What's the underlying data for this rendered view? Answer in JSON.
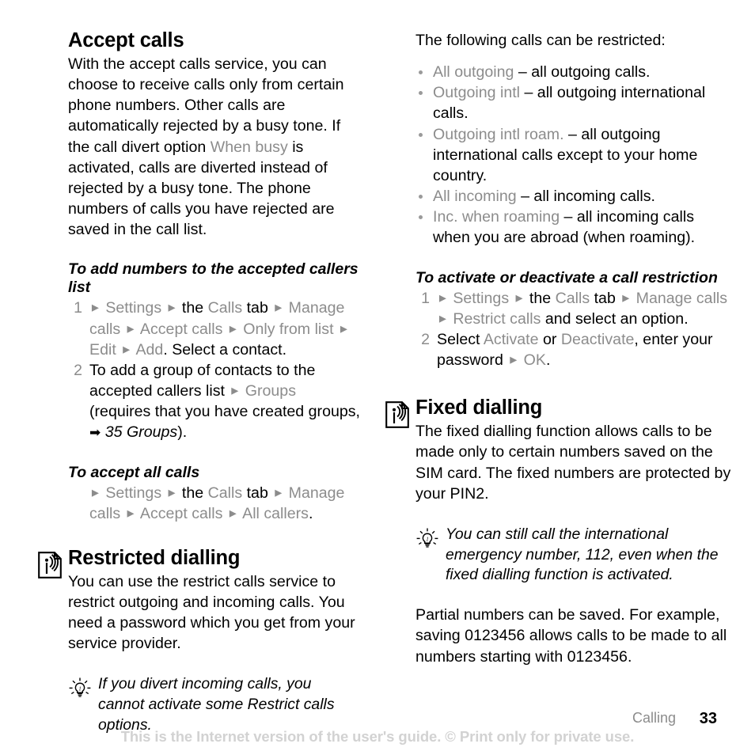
{
  "document": {
    "page_number": "33",
    "chapter": "Calling",
    "notice": "This is the Internet version of the user's guide. © Print only for private use."
  },
  "left_column": {
    "accept_calls": {
      "heading": "Accept calls",
      "intro_part1": "With the accept calls service, you can choose to receive calls only from certain phone numbers. Other calls are automatically rejected by a busy tone. If the call divert option ",
      "intro_menu": "When busy",
      "intro_part2": " is activated, calls are diverted instead of rejected by a busy tone. The phone numbers of calls you have rejected are saved in the call list."
    },
    "add_numbers_task": {
      "heading": "To add numbers to the accepted callers list",
      "step1": {
        "num": "1",
        "m_settings": "Settings",
        "the": "the",
        "m_calls_tab": "Calls",
        "tab_word": "tab",
        "m_manage_calls": "Manage calls",
        "m_accept_calls": "Accept calls",
        "m_only_from_list": "Only from list",
        "m_edit": "Edit",
        "m_add": "Add",
        "tail": ". Select a contact."
      },
      "step2": {
        "num": "2",
        "text_before": "To add a group of contacts to the accepted callers list ",
        "m_groups": "Groups",
        "text_mid": " (requires that you have created groups, ",
        "arrow": "➡",
        "ref": "35 Groups",
        "text_after": ")."
      }
    },
    "accept_all_task": {
      "heading": "To accept all calls",
      "m_settings": "Settings",
      "the": "the",
      "m_calls_tab": "Calls",
      "tab_word": "tab",
      "m_manage_calls": "Manage calls",
      "m_accept_calls": "Accept calls",
      "m_all_callers": "All callers",
      "tail": "."
    },
    "restricted_dialling": {
      "icon": "sim-card-icon",
      "heading": "Restricted dialling",
      "body": "You can use the restrict calls service to restrict outgoing and incoming calls. You need a password which you get from your service provider."
    },
    "tip": {
      "icon": "lightbulb-tip-icon",
      "text": "If you divert incoming calls, you cannot activate some Restrict calls options."
    }
  },
  "right_column": {
    "restrict_intro": "The following calls can be restricted:",
    "restrict_options": [
      {
        "name": "All outgoing",
        "desc": " – all outgoing calls."
      },
      {
        "name": "Outgoing intl",
        "desc": " – all outgoing international calls."
      },
      {
        "name": "Outgoing intl roam.",
        "desc": " – all outgoing international calls except to your home country."
      },
      {
        "name": "All incoming",
        "desc": " – all incoming calls."
      },
      {
        "name": "Inc. when roaming",
        "desc": " – all incoming calls when you are abroad (when roaming)."
      }
    ],
    "activate_task": {
      "heading": "To activate or deactivate a call restriction",
      "step1": {
        "num": "1",
        "m_settings": "Settings",
        "the": "the",
        "m_calls_tab": "Calls",
        "tab_word": "tab",
        "m_manage_calls": "Manage calls",
        "m_restrict_calls": "Restrict calls",
        "tail": " and select an option."
      },
      "step2": {
        "num": "2",
        "select_word": "Select ",
        "m_activate": "Activate",
        "or_word": " or ",
        "m_deactivate": "Deactivate",
        "mid": ", enter your password ",
        "m_ok": "OK",
        "tail": "."
      }
    },
    "fixed_dialling": {
      "icon": "sim-card-icon",
      "heading": "Fixed dialling",
      "body": "The fixed dialling function allows calls to be made only to certain numbers saved on the SIM card. The fixed numbers are protected by your PIN2."
    },
    "tip": {
      "icon": "lightbulb-tip-icon",
      "text": "You can still call the international emergency number, 112, even when the fixed dialling function is activated."
    },
    "partial_numbers": "Partial numbers can be saved. For example, saving 0123456 allows calls to be made to all numbers starting with 0123456."
  },
  "colors": {
    "menu_gray": "#8c8c8c",
    "body_black": "#000000",
    "notice_gray": "#d2d2d2"
  }
}
